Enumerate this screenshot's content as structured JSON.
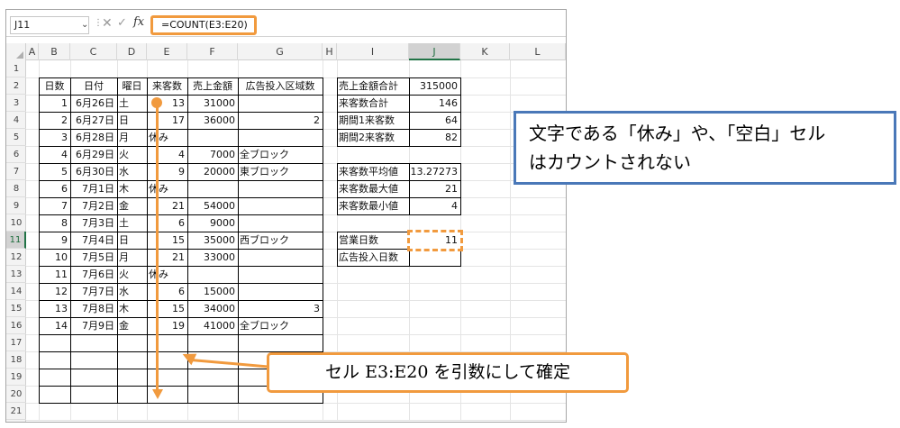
{
  "formula_bar": {
    "name_box": "J11",
    "name_box_arrow": "⌄",
    "dots": "⋮",
    "cancel": "✕",
    "enter": "✓",
    "fx": "fx",
    "formula": "=COUNT(E3:E20)"
  },
  "columns": [
    "A",
    "B",
    "C",
    "D",
    "E",
    "F",
    "G",
    "H",
    "I",
    "J",
    "K",
    "L"
  ],
  "rows": [
    "1",
    "2",
    "3",
    "4",
    "5",
    "6",
    "7",
    "8",
    "9",
    "10",
    "11",
    "12",
    "13",
    "14",
    "15",
    "16",
    "17",
    "18",
    "19",
    "20",
    "21"
  ],
  "main_table": {
    "headers": [
      "日数",
      "日付",
      "曜日",
      "来客数",
      "売上金額",
      "広告投入区域数"
    ],
    "rows": [
      [
        "1",
        "6月26日",
        "土",
        "13",
        "31000",
        ""
      ],
      [
        "2",
        "6月27日",
        "日",
        "17",
        "36000",
        "2"
      ],
      [
        "3",
        "6月28日",
        "月",
        "休み",
        "",
        ""
      ],
      [
        "4",
        "6月29日",
        "火",
        "4",
        "7000",
        "全ブロック"
      ],
      [
        "5",
        "6月30日",
        "水",
        "9",
        "20000",
        "東ブロック"
      ],
      [
        "6",
        "7月1日",
        "木",
        "休み",
        "",
        ""
      ],
      [
        "7",
        "7月2日",
        "金",
        "21",
        "54000",
        ""
      ],
      [
        "8",
        "7月3日",
        "土",
        "6",
        "9000",
        ""
      ],
      [
        "9",
        "7月4日",
        "日",
        "15",
        "35000",
        "西ブロック"
      ],
      [
        "10",
        "7月5日",
        "月",
        "21",
        "33000",
        ""
      ],
      [
        "11",
        "7月6日",
        "火",
        "休み",
        "",
        ""
      ],
      [
        "12",
        "7月7日",
        "水",
        "6",
        "15000",
        ""
      ],
      [
        "13",
        "7月8日",
        "木",
        "15",
        "34000",
        "3"
      ],
      [
        "14",
        "7月9日",
        "金",
        "19",
        "41000",
        "全ブロック"
      ]
    ]
  },
  "summary1": [
    {
      "label": "売上金額合計",
      "value": "315000"
    },
    {
      "label": "来客数合計",
      "value": "146"
    },
    {
      "label": "期間1来客数",
      "value": "64"
    },
    {
      "label": "期間2来客数",
      "value": "82"
    }
  ],
  "summary2": [
    {
      "label": "来客数平均値",
      "value": "13.27273"
    },
    {
      "label": "来客数最大値",
      "value": "21"
    },
    {
      "label": "来客数最小値",
      "value": "4"
    }
  ],
  "summary3": [
    {
      "label": "営業日数",
      "value": "11"
    },
    {
      "label": "広告投入日数",
      "value": ""
    }
  ],
  "callouts": {
    "text_note_line1": "文字である「休み」や、「空白」セル",
    "text_note_line2": "はカウントされない",
    "range_note": "セル E3:E20 を引数にして確定"
  },
  "colors": {
    "accent_orange": "#f19a3e",
    "accent_blue": "#4a78b8",
    "selection_green": "#217346"
  }
}
